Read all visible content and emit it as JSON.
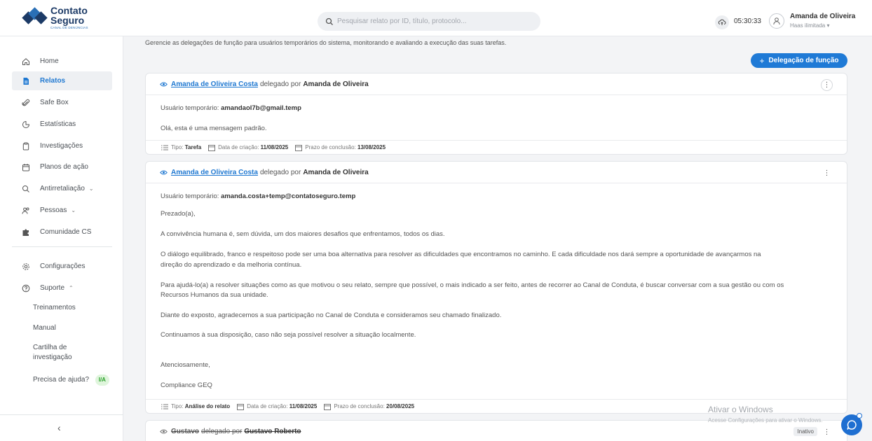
{
  "brand": {
    "line1": "Contato",
    "line2": "Seguro",
    "tagline": "CANAL DE DENÚNCIAS"
  },
  "search": {
    "placeholder": "Pesquisar relato por ID, título, protocolo..."
  },
  "header": {
    "clock": "05:30:33",
    "user_name": "Amanda de Oliveira",
    "user_company": "Haas ilimitada ▾"
  },
  "sidebar": {
    "items": [
      {
        "label": "Home",
        "icon": "home-icon"
      },
      {
        "label": "Relatos",
        "icon": "document-icon"
      },
      {
        "label": "Safe Box",
        "icon": "paperclip-icon"
      },
      {
        "label": "Estatísticas",
        "icon": "pie-chart-icon"
      },
      {
        "label": "Investigações",
        "icon": "clipboard-icon"
      },
      {
        "label": "Planos de ação",
        "icon": "calendar-icon"
      },
      {
        "label": "Antirretaliação",
        "icon": "search-icon"
      },
      {
        "label": "Pessoas",
        "icon": "people-icon"
      },
      {
        "label": "Comunidade CS",
        "icon": "puzzle-icon"
      },
      {
        "label": "Configurações",
        "icon": "gear-icon"
      },
      {
        "label": "Suporte",
        "icon": "help-circle-icon"
      }
    ],
    "support_items": [
      "Treinamentos",
      "Manual",
      "Cartilha de",
      "investigação",
      "Precisa de ajuda?"
    ],
    "help_badge": "I/A"
  },
  "main": {
    "intro": "Gerencie as delegações de função para usuários temporários do sistema, monitorando e avaliando a execução das suas tarefas.",
    "add_button": "Delegação de função",
    "cards": [
      {
        "user_link": "Amanda de Oliveira Costa",
        "delegated_by_text": "delegado por",
        "delegated_by": "Amanda de Oliveira",
        "temp_user_label": "Usuário temporário:",
        "temp_user": "amandaol7b@gmail.temp",
        "message": [
          "Olá, esta é uma mensagem padrão."
        ],
        "type_label": "Tipo:",
        "type": "Tarefa",
        "created_label": "Data de criação:",
        "created": "11/08/2025",
        "due_label": "Prazo de conclusão:",
        "due": "13/08/2025"
      },
      {
        "user_link": "Amanda de Oliveira Costa",
        "delegated_by_text": "delegado por",
        "delegated_by": "Amanda de Oliveira",
        "temp_user_label": "Usuário temporário:",
        "temp_user": "amanda.costa+temp@contatoseguro.temp",
        "message": [
          "Prezado(a),",
          "A convivência humana é, sem dúvida, um dos maiores desafios que enfrentamos, todos os dias.",
          "O diálogo equilibrado, franco e respeitoso pode ser uma boa alternativa para resolver as dificuldades que encontramos no caminho. E cada dificuldade nos dará sempre a oportunidade de avançarmos na",
          "direção do aprendizado e da melhoria contínua.",
          "Para ajudá-lo(a) a resolver situações como as que motivou o seu relato, sempre que possível, o mais indicado a ser feito, antes de recorrer ao Canal de Conduta, é buscar conversar com a sua gestão ou com os",
          "Recursos Humanos da sua unidade.",
          "Diante do exposto, agradecemos a sua participação no Canal de Conduta e consideramos seu chamado finalizado.",
          "Continuamos à sua disposição, caso não seja possível resolver a situação localmente.",
          "Atenciosamente,",
          "Compliance GEQ"
        ],
        "type_label": "Tipo:",
        "type": "Análise do relato",
        "created_label": "Data de criação:",
        "created": "11/08/2025",
        "due_label": "Prazo de conclusão:",
        "due": "20/08/2025"
      },
      {
        "user_link": "Gustavo",
        "delegated_by_text": "delegado por",
        "delegated_by": "Gustavo Roberto",
        "status": "Inativo"
      }
    ]
  },
  "watermark": {
    "line1": "Ativar o Windows",
    "line2": "Acesse Configurações para ativar o Windows."
  },
  "colors": {
    "accent": "#1f78d1",
    "brand": "#1c3a66"
  }
}
